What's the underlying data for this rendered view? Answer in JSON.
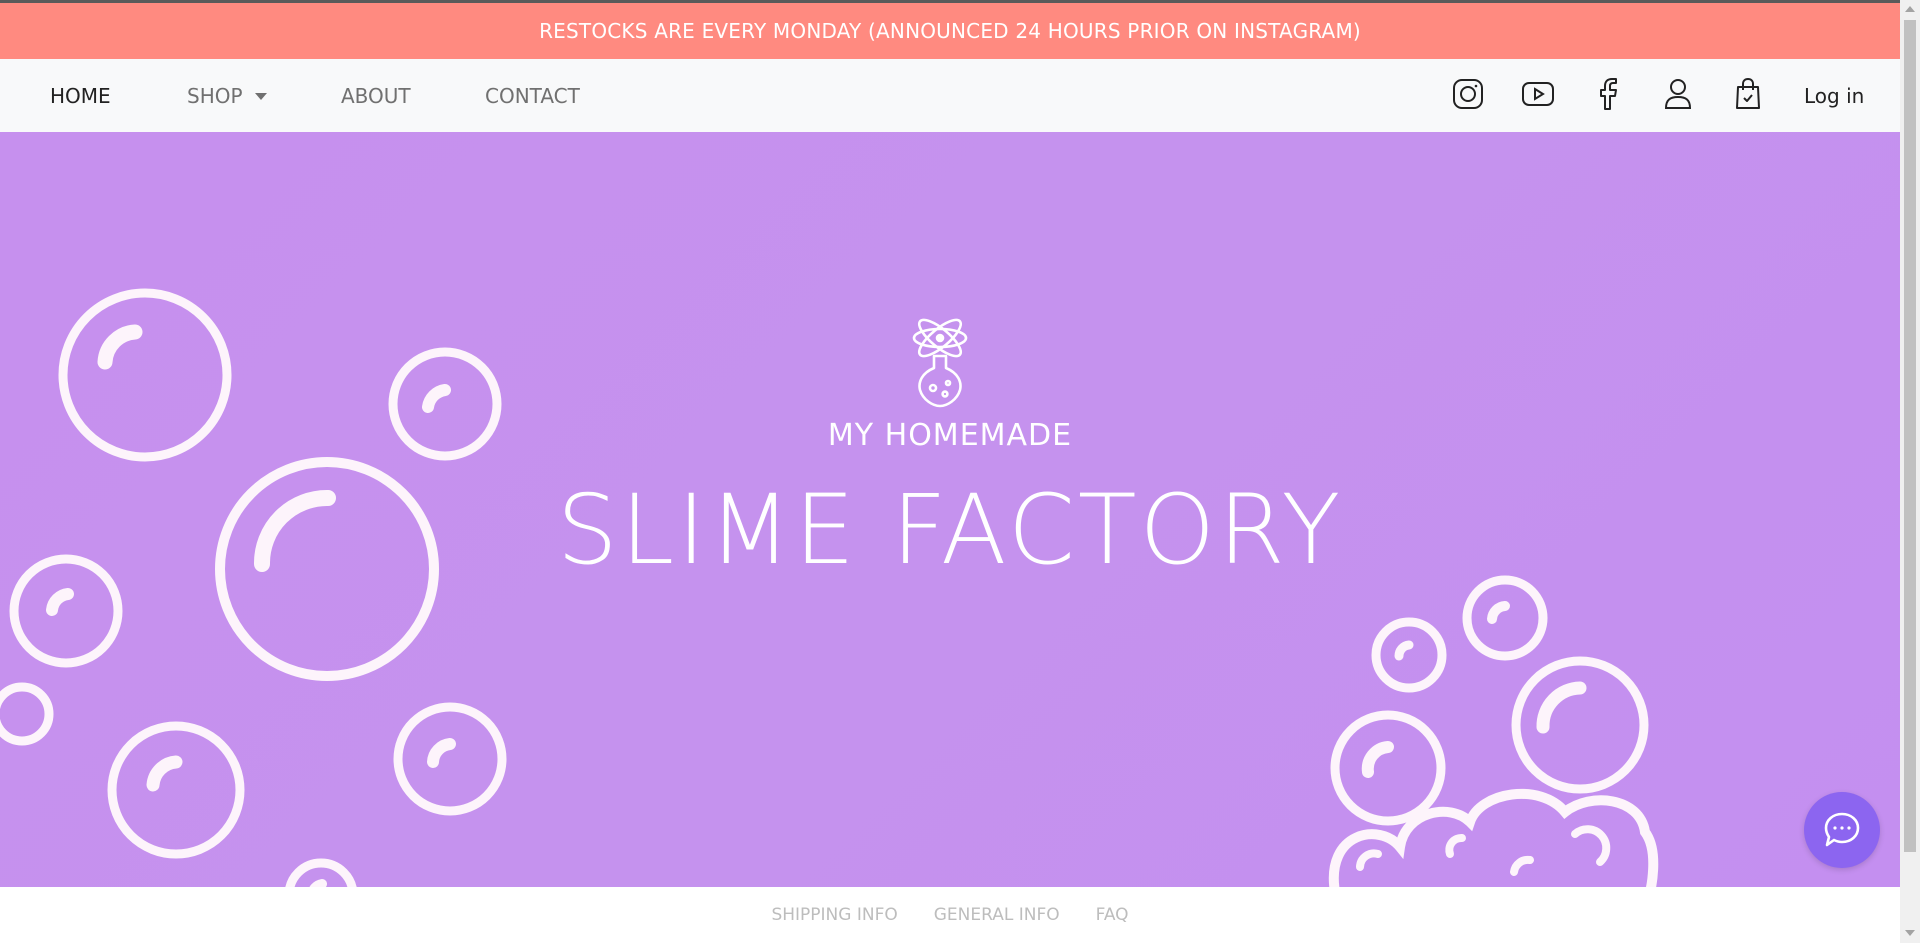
{
  "announcement": {
    "text": "RESTOCKS ARE EVERY MONDAY (ANNOUNCED 24 HOURS PRIOR ON INSTAGRAM)"
  },
  "nav": {
    "links": [
      {
        "label": "HOME",
        "active": true
      },
      {
        "label": "SHOP",
        "active": false,
        "has_dropdown": true
      },
      {
        "label": "ABOUT",
        "active": false
      },
      {
        "label": "CONTACT",
        "active": false
      }
    ],
    "icons": [
      "instagram-icon",
      "youtube-icon",
      "facebook-icon",
      "account-icon",
      "shopping-bag-icon"
    ],
    "login_label": "Log in"
  },
  "hero": {
    "logo_icon": "flask-atom-icon",
    "subtitle": "MY HOMEMADE",
    "title": "SLIME FACTORY",
    "background_color": "#c690ee"
  },
  "footer": {
    "links": [
      "SHIPPING INFO",
      "GENERAL INFO",
      "FAQ"
    ]
  },
  "chat": {
    "icon": "chat-bubble-icon",
    "color": "#8c65f0"
  },
  "colors": {
    "banner": "#ff8a80",
    "navbar": "#f8f9fa"
  }
}
